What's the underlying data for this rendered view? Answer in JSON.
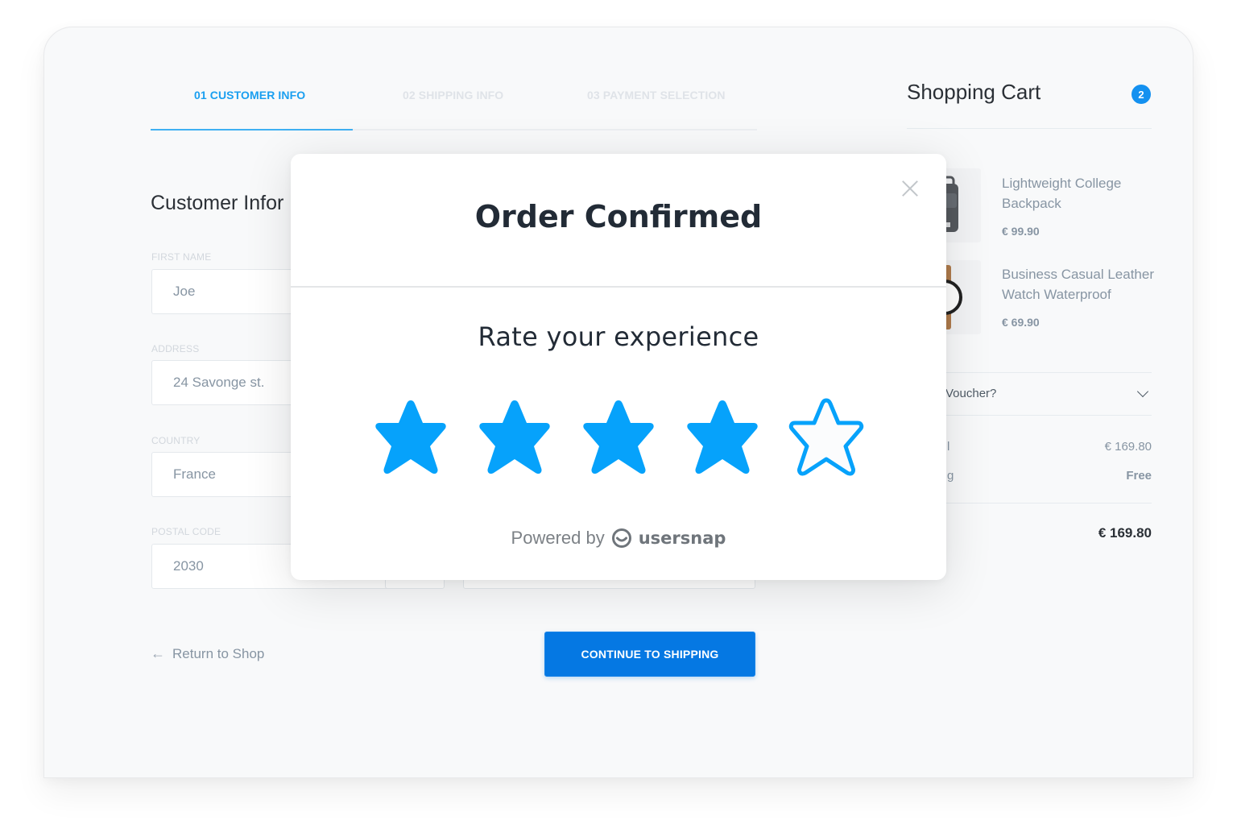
{
  "steps": [
    {
      "label": "01 CUSTOMER INFO",
      "active": true
    },
    {
      "label": "02 SHIPPING INFO",
      "active": false
    },
    {
      "label": "03 PAYMENT SELECTION",
      "active": false
    }
  ],
  "form": {
    "title": "Customer Infor",
    "fields": [
      {
        "label": "FIRST NAME",
        "value": "Joe"
      },
      {
        "label": "ADDRESS",
        "value": "24 Savonge st."
      },
      {
        "label": "COUNTRY",
        "value": "France"
      },
      {
        "label": "POSTAL CODE",
        "value": "2030"
      }
    ],
    "return_label": "Return to Shop",
    "continue_label": "CONTINUE TO SHIPPING"
  },
  "cart": {
    "title": "Shopping Cart",
    "count": "2",
    "items": [
      {
        "name": "Lightweight College Backpack",
        "price": "€ 99.90",
        "icon": "backpack-icon"
      },
      {
        "name": "Business Casual Leather Watch Waterproof",
        "price": "€ 69.90",
        "icon": "watch-icon"
      }
    ],
    "voucher_label": "Voucher?",
    "subtotal_label": "l",
    "subtotal_value": "€ 169.80",
    "shipping_label": "g",
    "shipping_value": "Free",
    "total_value": "€ 169.80"
  },
  "modal": {
    "title": "Order Confirmed",
    "subtitle": "Rate your experience",
    "rating": 4,
    "rating_max": 5,
    "powered_by": "Powered by",
    "brand": "usersnap"
  },
  "colors": {
    "accent": "#1a9ff0",
    "star": "#06a2fb",
    "button": "#0578e3"
  }
}
